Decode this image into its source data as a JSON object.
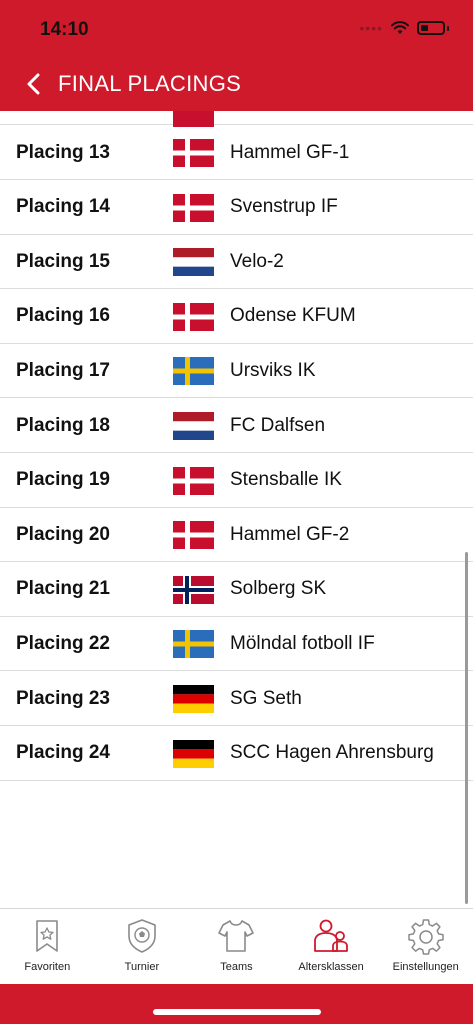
{
  "status": {
    "time": "14:10"
  },
  "nav": {
    "title": "FINAL PLACINGS"
  },
  "rows": [
    {
      "place": "Placing 13",
      "flag": "dk",
      "team": "Hammel GF-1"
    },
    {
      "place": "Placing 14",
      "flag": "dk",
      "team": "Svenstrup IF"
    },
    {
      "place": "Placing 15",
      "flag": "nl",
      "team": "Velo-2"
    },
    {
      "place": "Placing 16",
      "flag": "dk",
      "team": "Odense KFUM"
    },
    {
      "place": "Placing 17",
      "flag": "se",
      "team": "Ursviks IK"
    },
    {
      "place": "Placing 18",
      "flag": "nl",
      "team": "FC Dalfsen"
    },
    {
      "place": "Placing 19",
      "flag": "dk",
      "team": "Stensballe IK"
    },
    {
      "place": "Placing 20",
      "flag": "dk",
      "team": "Hammel GF-2"
    },
    {
      "place": "Placing 21",
      "flag": "no",
      "team": "Solberg SK"
    },
    {
      "place": "Placing 22",
      "flag": "se",
      "team": "Mölndal fotboll IF"
    },
    {
      "place": "Placing 23",
      "flag": "de",
      "team": "SG Seth"
    },
    {
      "place": "Placing 24",
      "flag": "de",
      "team": "SCC Hagen Ahrensburg"
    }
  ],
  "tabs": [
    {
      "label": "Favoriten",
      "icon": "bookmark-star-icon",
      "active": false
    },
    {
      "label": "Turnier",
      "icon": "shield-ball-icon",
      "active": false
    },
    {
      "label": "Teams",
      "icon": "jersey-icon",
      "active": false
    },
    {
      "label": "Altersklassen",
      "icon": "people-icon",
      "active": true
    },
    {
      "label": "Einstellungen",
      "icon": "gear-icon",
      "active": false
    }
  ],
  "colors": {
    "brand": "#cf1a2c",
    "active_icon": "#cf1a2c",
    "inactive_icon": "#8a8a8a"
  }
}
